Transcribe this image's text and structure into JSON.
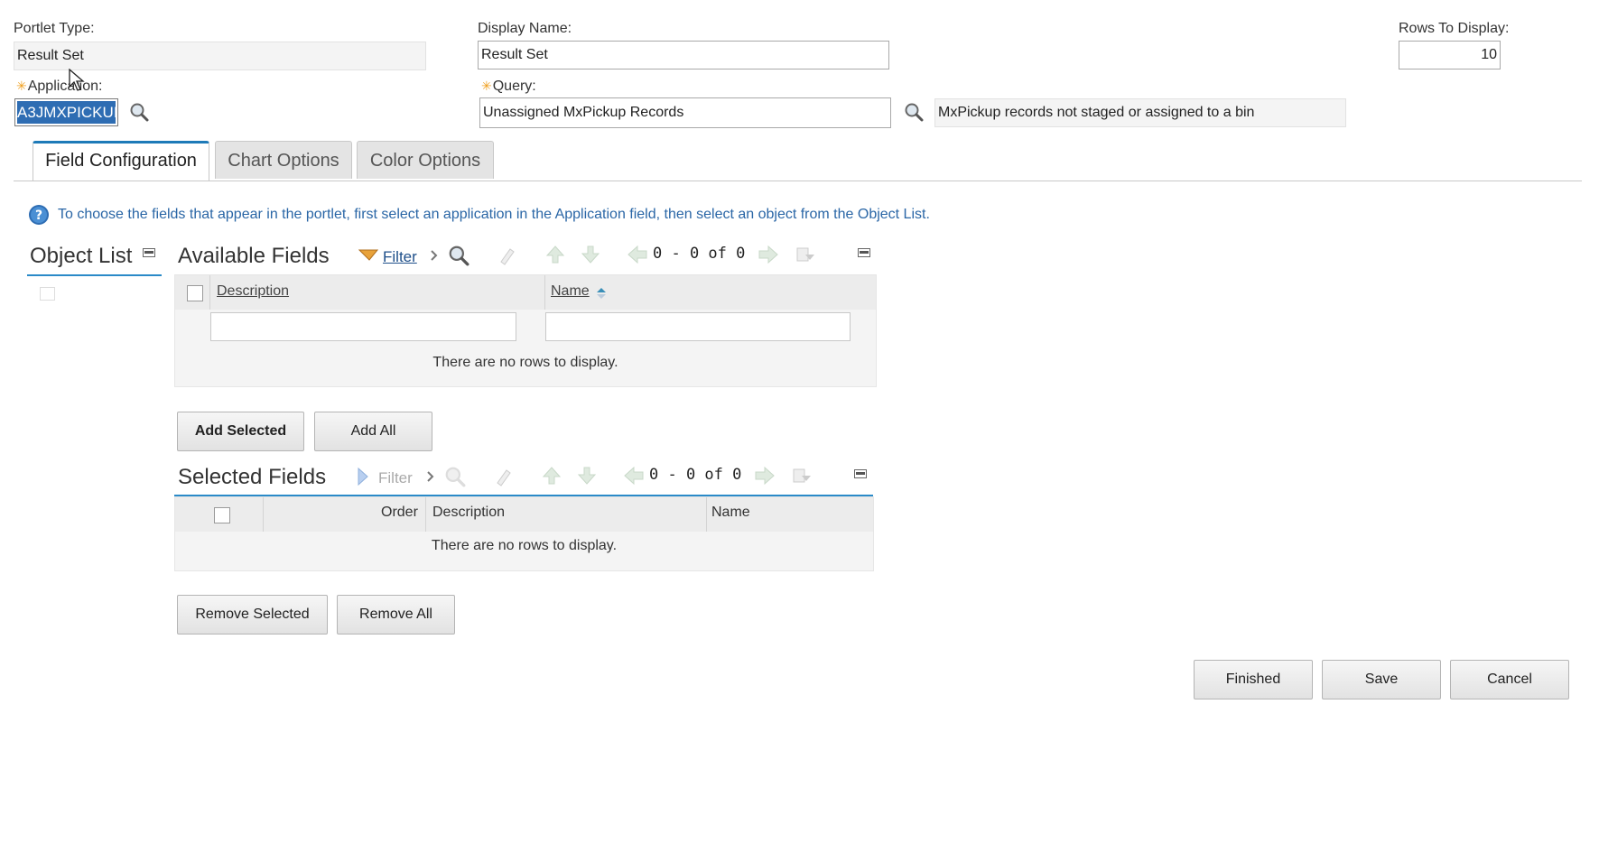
{
  "header": {
    "portlet_type_label": "Portlet Type:",
    "portlet_type_value": "Result Set",
    "display_name_label": "Display Name:",
    "display_name_value": "Result Set",
    "rows_label": "Rows To Display:",
    "rows_value": "10",
    "application_label": "Application:",
    "application_value": "A3JMXPICKUI",
    "query_label": "Query:",
    "query_value": "Unassigned MxPickup Records",
    "query_description": "MxPickup records not staged or assigned to a bin",
    "required_marker": "✳"
  },
  "tabs": [
    {
      "label": "Field Configuration",
      "active": true
    },
    {
      "label": "Chart Options",
      "active": false
    },
    {
      "label": "Color Options",
      "active": false
    }
  ],
  "help_text": "To choose the fields that appear in the portlet, first select an application in the Application field, then select an object from the Object List.",
  "object_list": {
    "title": "Object List"
  },
  "available_fields": {
    "title": "Available Fields",
    "filter_label": "Filter",
    "pager": "0 - 0 of 0",
    "columns": [
      "Description",
      "Name"
    ],
    "empty_text": "There are no rows to display."
  },
  "add_buttons": {
    "add_selected": "Add Selected",
    "add_all": "Add All"
  },
  "selected_fields": {
    "title": "Selected Fields",
    "filter_label": "Filter",
    "pager": "0 - 0 of 0",
    "columns": [
      "Order",
      "Description",
      "Name"
    ],
    "empty_text": "There are no rows to display."
  },
  "remove_buttons": {
    "remove_selected": "Remove Selected",
    "remove_all": "Remove All"
  },
  "footer_buttons": {
    "finished": "Finished",
    "save": "Save",
    "cancel": "Cancel"
  },
  "colors": {
    "accent": "#1e7ab8",
    "help_text": "#2a66a6",
    "required": "#f0a020"
  }
}
